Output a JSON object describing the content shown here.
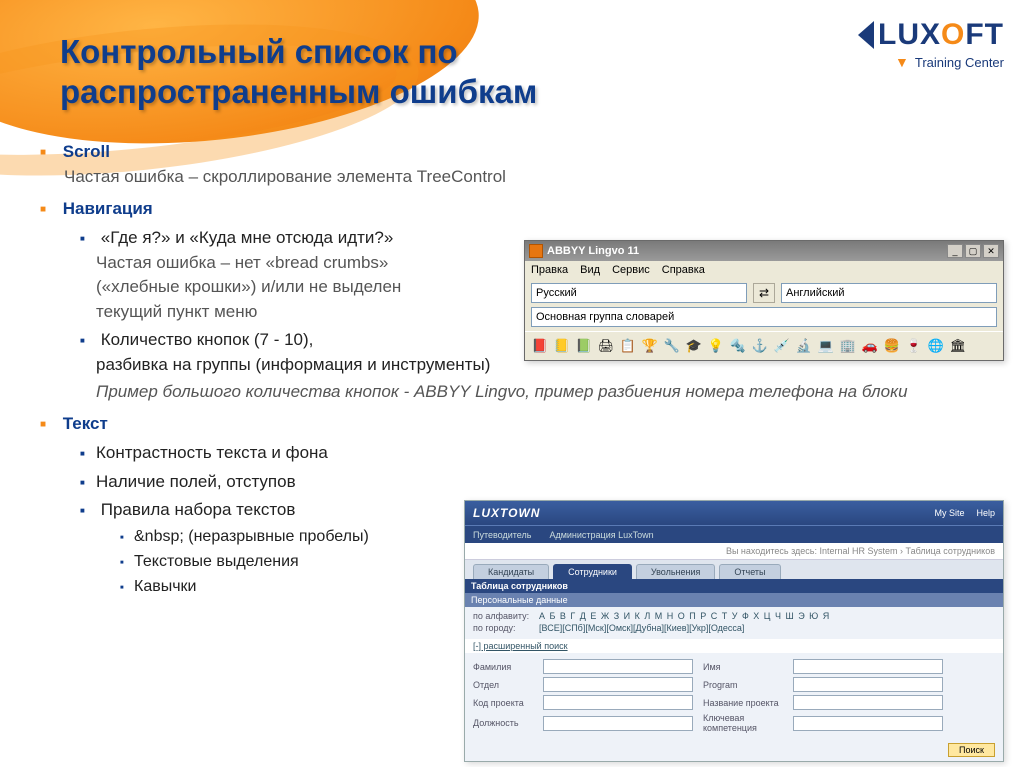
{
  "logo": {
    "name": "LUXOFT",
    "sub": "Training Center"
  },
  "title": "Контрольный список по распространенным ошибкам",
  "bullets": {
    "scroll": {
      "head": "Scroll",
      "sub": "Частая ошибка – скроллирование элемента TreeControl"
    },
    "nav": {
      "head": "Навигация",
      "q": "«Где я?» и «Куда мне отсюда идти?»",
      "err": "Частая ошибка – нет «bread crumbs»",
      "err2": "(«хлебные крошки») и/или не выделен",
      "err3": "текущий пункт меню",
      "btns": "Количество кнопок (7 - 10),",
      "btns2": "разбивка на группы (информация и инструменты)",
      "example": "Пример большого количества кнопок - ABBYY Lingvo, пример разбиения номера телефона на блоки"
    },
    "text": {
      "head": "Текст",
      "i1": "Контрастность текста и фона",
      "i2": "Наличие полей, отступов",
      "i3": "Правила набора текстов",
      "s1": "&nbsp; (неразрывные пробелы)",
      "s2": "Текстовые выделения",
      "s3": "Кавычки"
    }
  },
  "abbyy": {
    "title": "ABBYY Lingvo 11",
    "menu": [
      "Правка",
      "Вид",
      "Сервис",
      "Справка"
    ],
    "langFrom": "Русский",
    "langTo": "Английский",
    "group": "Основная группа словарей",
    "icons": [
      "📕",
      "📒",
      "📗",
      "🖨",
      "📋",
      "🏆",
      "🔧",
      "🎓",
      "💡",
      "🔩",
      "⚓",
      "💉",
      "🔬",
      "💻",
      "🏢",
      "🚗",
      "🍔",
      "🍷",
      "🌐",
      "🏛"
    ]
  },
  "luxtown": {
    "brand": "LUXTOWN",
    "topLinks": [
      "My Site",
      "Help"
    ],
    "nav": [
      "Путеводитель",
      "Администрация LuxTown"
    ],
    "breadcrumb": "Вы находитесь здесь: Internal HR System › Таблица сотрудников",
    "tabs": [
      "Кандидаты",
      "Сотрудники",
      "Увольнения",
      "Отчеты"
    ],
    "tabActive": 1,
    "panelTitle": "Таблица сотрудников",
    "panelSub": "Персональные данные",
    "filters": {
      "alpha_lbl": "по алфавиту:",
      "alpha": "А Б В Г Д Е Ж З И К Л М Н О П Р С Т У Ф Х Ц Ч Ш Э Ю Я",
      "city_lbl": "по городу:",
      "cities": "[ВСЕ][СПб][Мск][Омск][Дубна][Киев][Укр][Одесса]"
    },
    "expand": "[-] расширенный поиск",
    "formLabels": {
      "fam": "Фамилия",
      "dept": "Отдел",
      "code": "Код проекта",
      "pos": "Должность",
      "name": "Имя",
      "prog": "Program",
      "proj": "Название проекта",
      "comp": "Ключевая компетенция"
    },
    "searchBtn": "Поиск"
  }
}
